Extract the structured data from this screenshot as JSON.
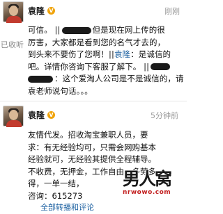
{
  "post1": {
    "username": "袁隆",
    "verified_icon": "v-badge",
    "timestamp": "刚刚",
    "favorite_label": "已收听",
    "line1_a": "可信。 ||",
    "line1_b": "但是现在网上传的很",
    "line2": "厉害，大家都是看到您的名气才去的，",
    "line3_a": "到头来不要伤了您啊！||",
    "line3_link": "袁隆",
    "line3_b": "：是诚信的",
    "line4_a": "吧。详情你咨询下客服了解下。 ||",
    "line5_a": "：这个爱淘人公司是不是诚信的，请",
    "line6": "袁老师说句话。。。"
  },
  "post2": {
    "username": "袁隆",
    "verified_icon": "v-badge",
    "timestamp": "5分钟前",
    "lines": [
      "友情代发。招收淘宝兼职人员，要",
      "求：有无经验均可，只需会网购基本",
      "经验就可，无经验其提供全程辅导。",
      "不收费，无押金，工作自由，多劳多",
      "得，一单一结，",
      "咨询：615273"
    ],
    "footer_link": "全部转播和评论"
  },
  "watermark": {
    "cn": "男人窝",
    "url": "nrwowo.com"
  }
}
